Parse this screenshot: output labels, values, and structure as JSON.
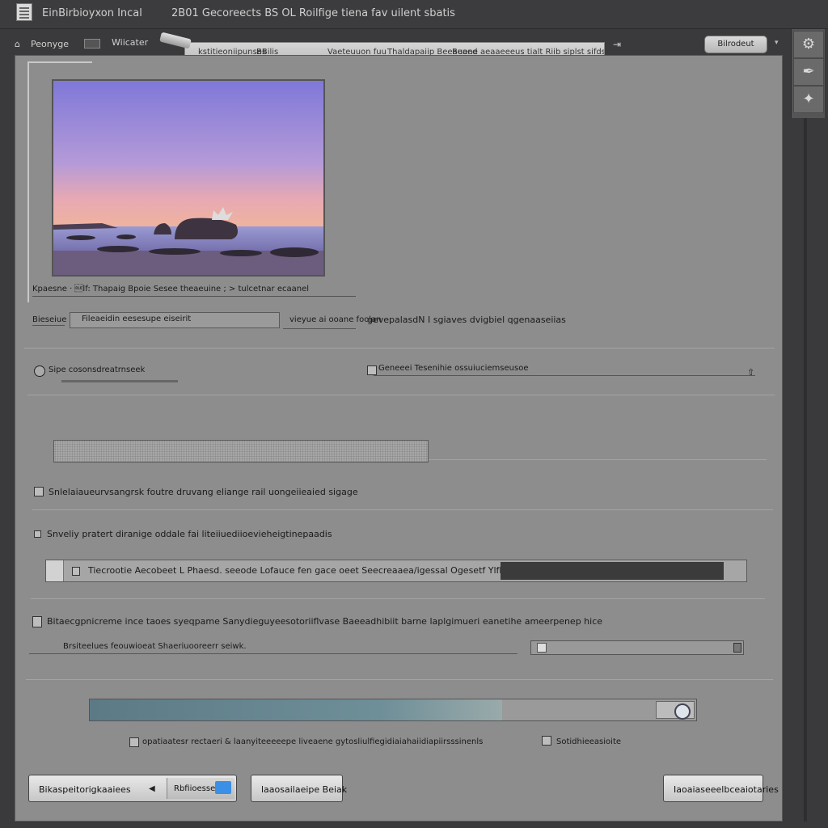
{
  "titlebar": {
    "app_name": "EinBirbioyxon Incal",
    "doc_title": "2B01 Gecoreects BS OL Roilfige tiena fav uilent sbatis"
  },
  "toolbar": {
    "left_label": "Peonyge",
    "tool_label": "Wiicater",
    "path_segments": [
      "kstitieoniipunses",
      "BBilis",
      "Vaeteuuon fuu",
      "Thaldapaiip Beeaeaed",
      "Buene aeaaeeeus tialt Riib siplst sifdss"
    ],
    "action_button": "Bilrodeut",
    "arrow": "⇥"
  },
  "tools": {
    "t1": "⚙",
    "t2": "✒",
    "t3": "✦"
  },
  "image_section": {
    "caption": "Kpaesne · \u0010lf: Thapaig Bpoie Sesee theaeuine ; > tulcetnar ecaanel",
    "row_left": "Bieseiue",
    "row_mid": "Fileaeidin eesesupe eiseirit",
    "row_right_a": "vieyue ai ooane foolan",
    "row_right_b": "gevepalasdN I sgiaves dvigbiel qgenaaseiias"
  },
  "radio_row": {
    "label_left": "Sipe cosonsdreatrnseek",
    "label_right": "Geneeei Tesenihie ossuiuciemseusoe"
  },
  "checkbox_1": "Snlelaiaueurvsangrsk foutre druvang eliange rail uongeiieaied sigage",
  "checkbox_2": "Snveliy pratert diranige oddale fai liteiiuediioevieheigtinepaadis",
  "file_strip": "Tiecrootie Aecobeet L Phaesd. seeode Lofauce fen gace oeet Seecreaaea/igessal Ogesetf Ylfbeiseonanoo lbes",
  "checkbox_3": "Bitaecgpnicreme ince taoes syeqpame Sanydieguyeesotoriiflvase Baeeadhibiit barne laplgimueri eanetihe ameerpenep hice",
  "sub_label": "Brsiteelues feouwioeat Shaeriuooreerr seiwk.",
  "footer_checks": {
    "left": "opatiaatesr rectaeri & laanyiteeeeepe liveaene gytosliulfiegidiaiahaiidiapiirsssinenls",
    "right": "Sotidhieeasioite"
  },
  "buttons": {
    "primary": "Bikaspeitorigkaaiees",
    "accent": "Rbfiioesse",
    "secondary": "laaosailaeipe Beiak",
    "confirm": "Iaoaiaseeelbceaiotaries"
  },
  "progress": {
    "value": 0.68
  },
  "slider": {
    "value": 0.02
  },
  "colors": {
    "sky_top": "#7f78d8",
    "sky_mid": "#b49ad8",
    "horizon": "#e8a9b2",
    "accent_blue": "#3a8fe6"
  }
}
